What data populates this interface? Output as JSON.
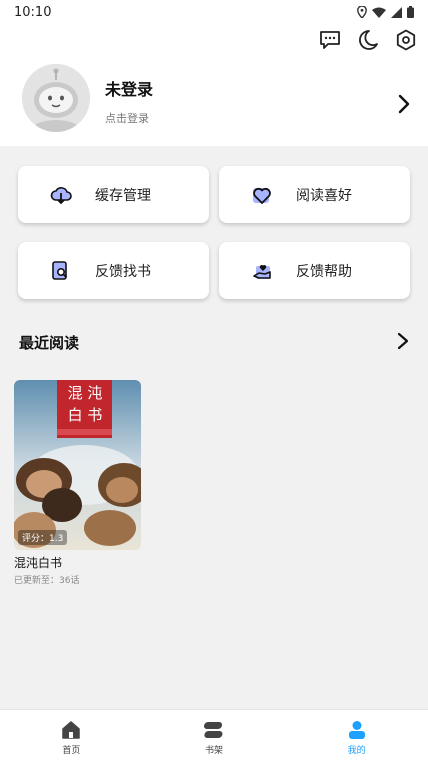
{
  "status_bar": {
    "time": "10:10"
  },
  "profile": {
    "name": "未登录",
    "subtitle": "点击登录"
  },
  "menu": [
    {
      "label": "缓存管理",
      "icon": "cloud-download-icon"
    },
    {
      "label": "阅读喜好",
      "icon": "heart-icon"
    },
    {
      "label": "反馈找书",
      "icon": "book-search-icon"
    },
    {
      "label": "反馈帮助",
      "icon": "hand-heart-icon"
    }
  ],
  "recent": {
    "title": "最近阅读",
    "books": [
      {
        "title": "混沌白书",
        "subtitle": "已更新至：36话",
        "rating": "评分：1.3",
        "cover_title": "混 沌 白 书"
      }
    ]
  },
  "bottom_nav": [
    {
      "label": "首页",
      "icon": "home-icon",
      "active": false
    },
    {
      "label": "书架",
      "icon": "bookshelf-icon",
      "active": false
    },
    {
      "label": "我的",
      "icon": "user-icon",
      "active": true
    }
  ],
  "colors": {
    "accent": "#1ea0ff",
    "background": "#f1f1f1"
  }
}
